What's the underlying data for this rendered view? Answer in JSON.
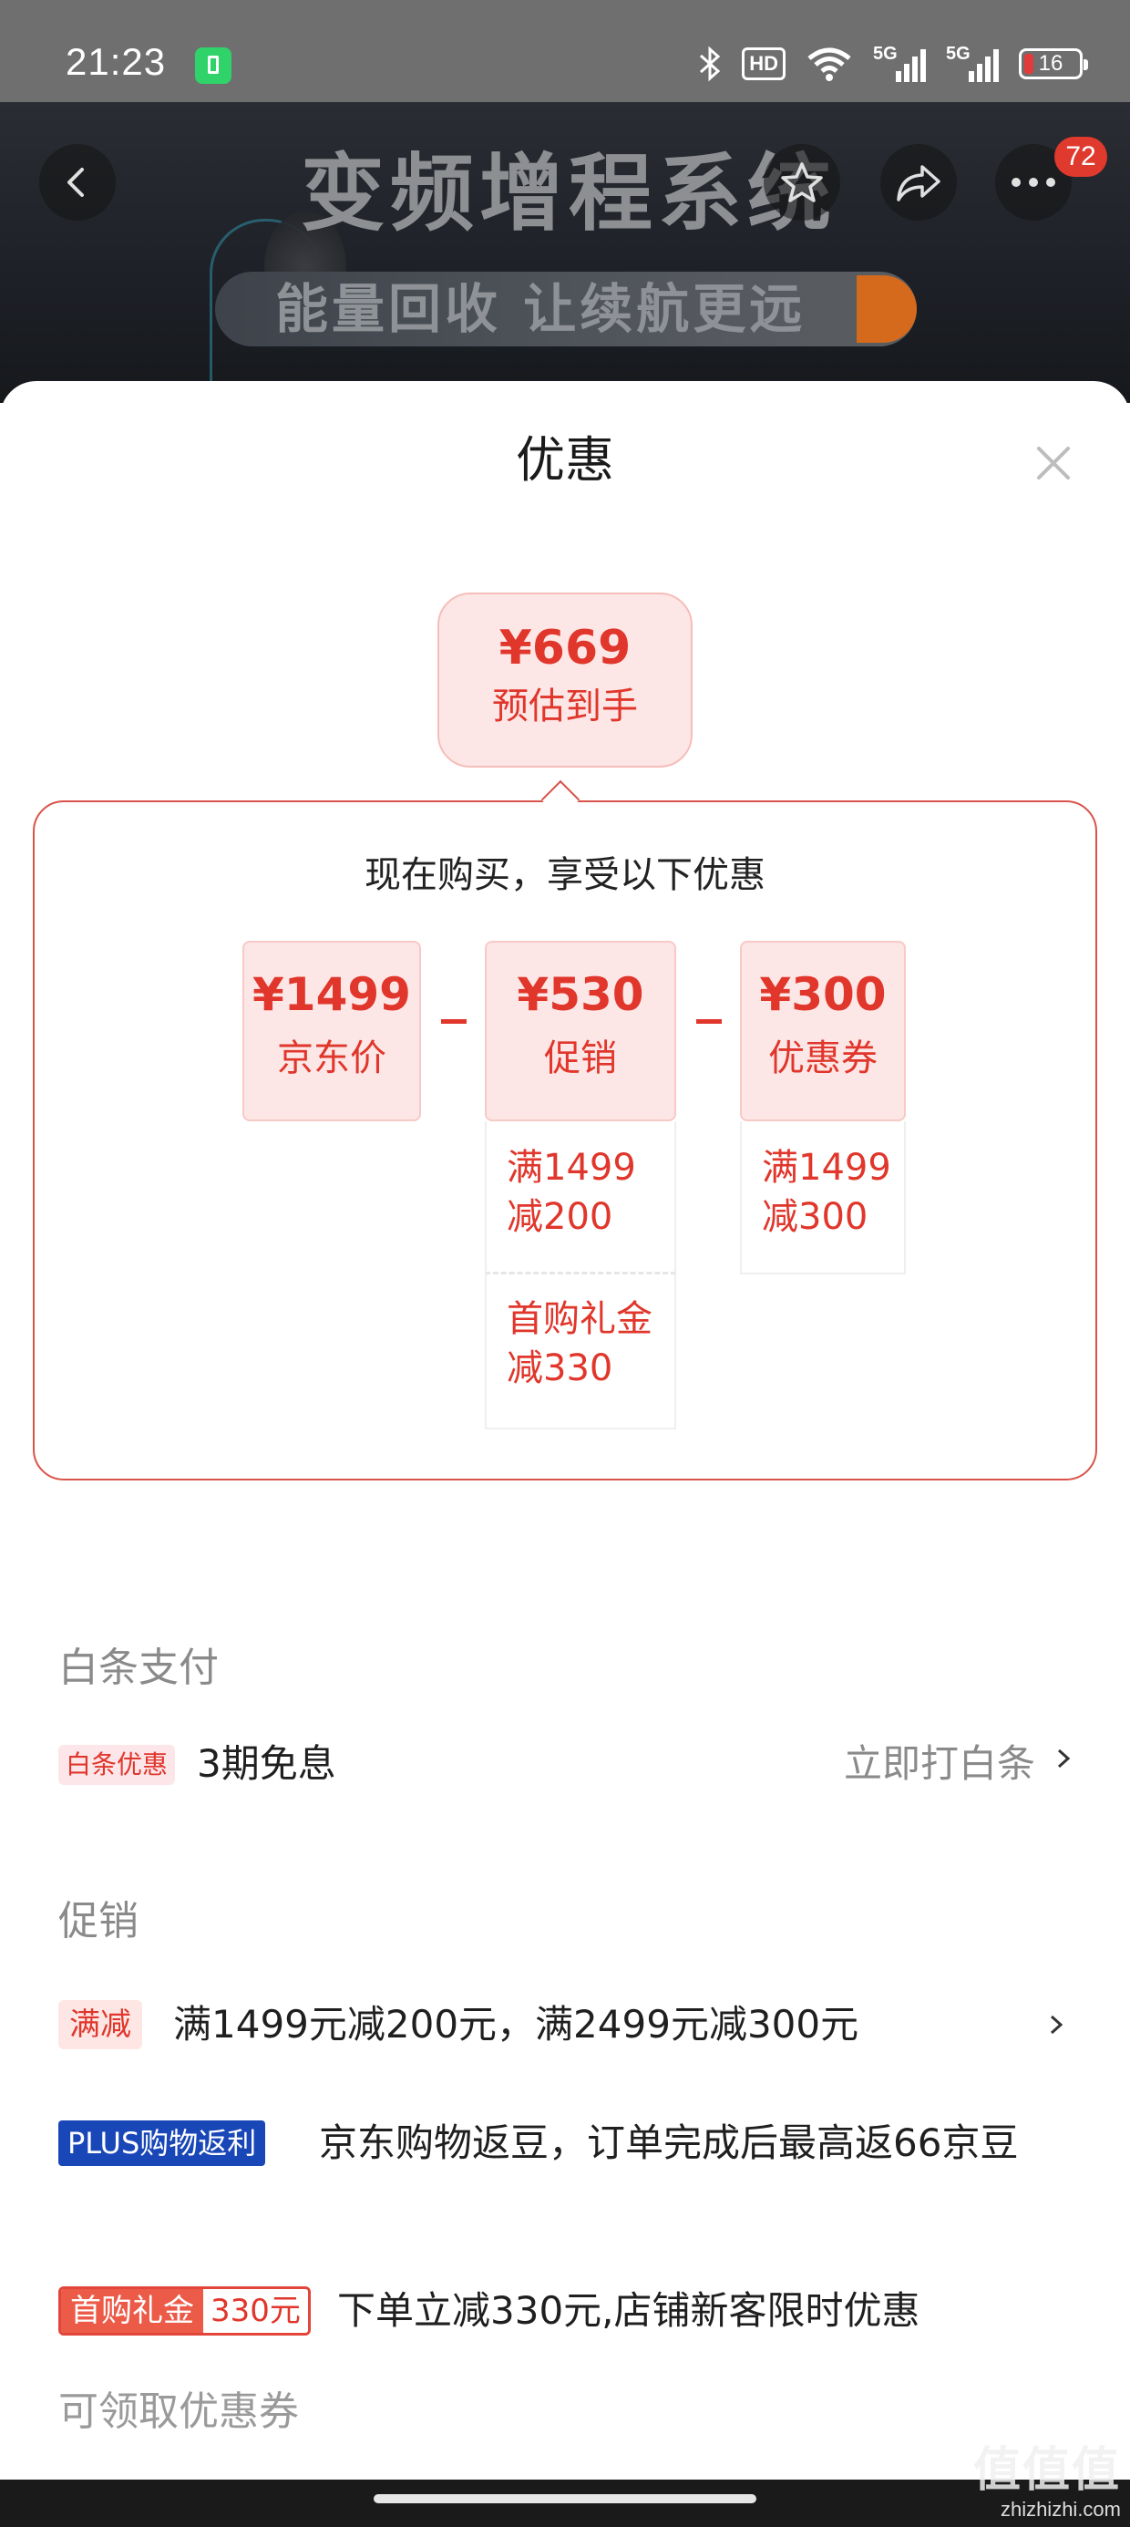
{
  "status_bar": {
    "time": "21:23",
    "network_1": "5G",
    "network_2": "5G",
    "hd": "HD",
    "battery": "16"
  },
  "banner": {
    "title": "变频增程系统",
    "pill_text": "能量回收 让续航更远",
    "more_badge": "72"
  },
  "sheet": {
    "title": "优惠",
    "total": {
      "price": "¥669",
      "label": "预估到手"
    },
    "breakdown": {
      "heading": "现在购买，享受以下优惠",
      "jd_price": {
        "amount": "¥1499",
        "label": "京东价"
      },
      "promotion": {
        "amount": "¥530",
        "label": "促销",
        "details": [
          "满1499\n减200",
          "首购礼金\n减330"
        ]
      },
      "coupon": {
        "amount": "¥300",
        "label": "优惠券",
        "details": [
          "满1499\n减300"
        ]
      }
    },
    "baitiao": {
      "section_title": "白条支付",
      "tag": "白条优惠",
      "text": "3期免息",
      "action": "立即打白条"
    },
    "promotion_section": {
      "section_title": "促销",
      "items": [
        {
          "tag": "满减",
          "text": "满1499元减200元，满2499元减300元"
        },
        {
          "tag": "PLUS购物返利",
          "text": "京东购物返豆，订单完成后最高返66京豆"
        },
        {
          "tag": "首购礼金",
          "tag_value": "330元",
          "text": "下单立减330元,店铺新客限时优惠"
        }
      ]
    },
    "coupon_section_title": "可领取优惠券"
  },
  "watermark": {
    "logo": "值值值",
    "url": "zhizhizhi.com"
  },
  "colors": {
    "accent_red": "#e0362b",
    "pink_bg": "#fde7e6",
    "plus_blue": "#1a47b8",
    "status_bar_bg": "#6f6f6f"
  },
  "icons": [
    "back-icon",
    "star-icon",
    "share-icon",
    "more-icon",
    "close-icon",
    "chevron-right-icon",
    "bluetooth-icon",
    "wifi-icon",
    "battery-icon"
  ]
}
